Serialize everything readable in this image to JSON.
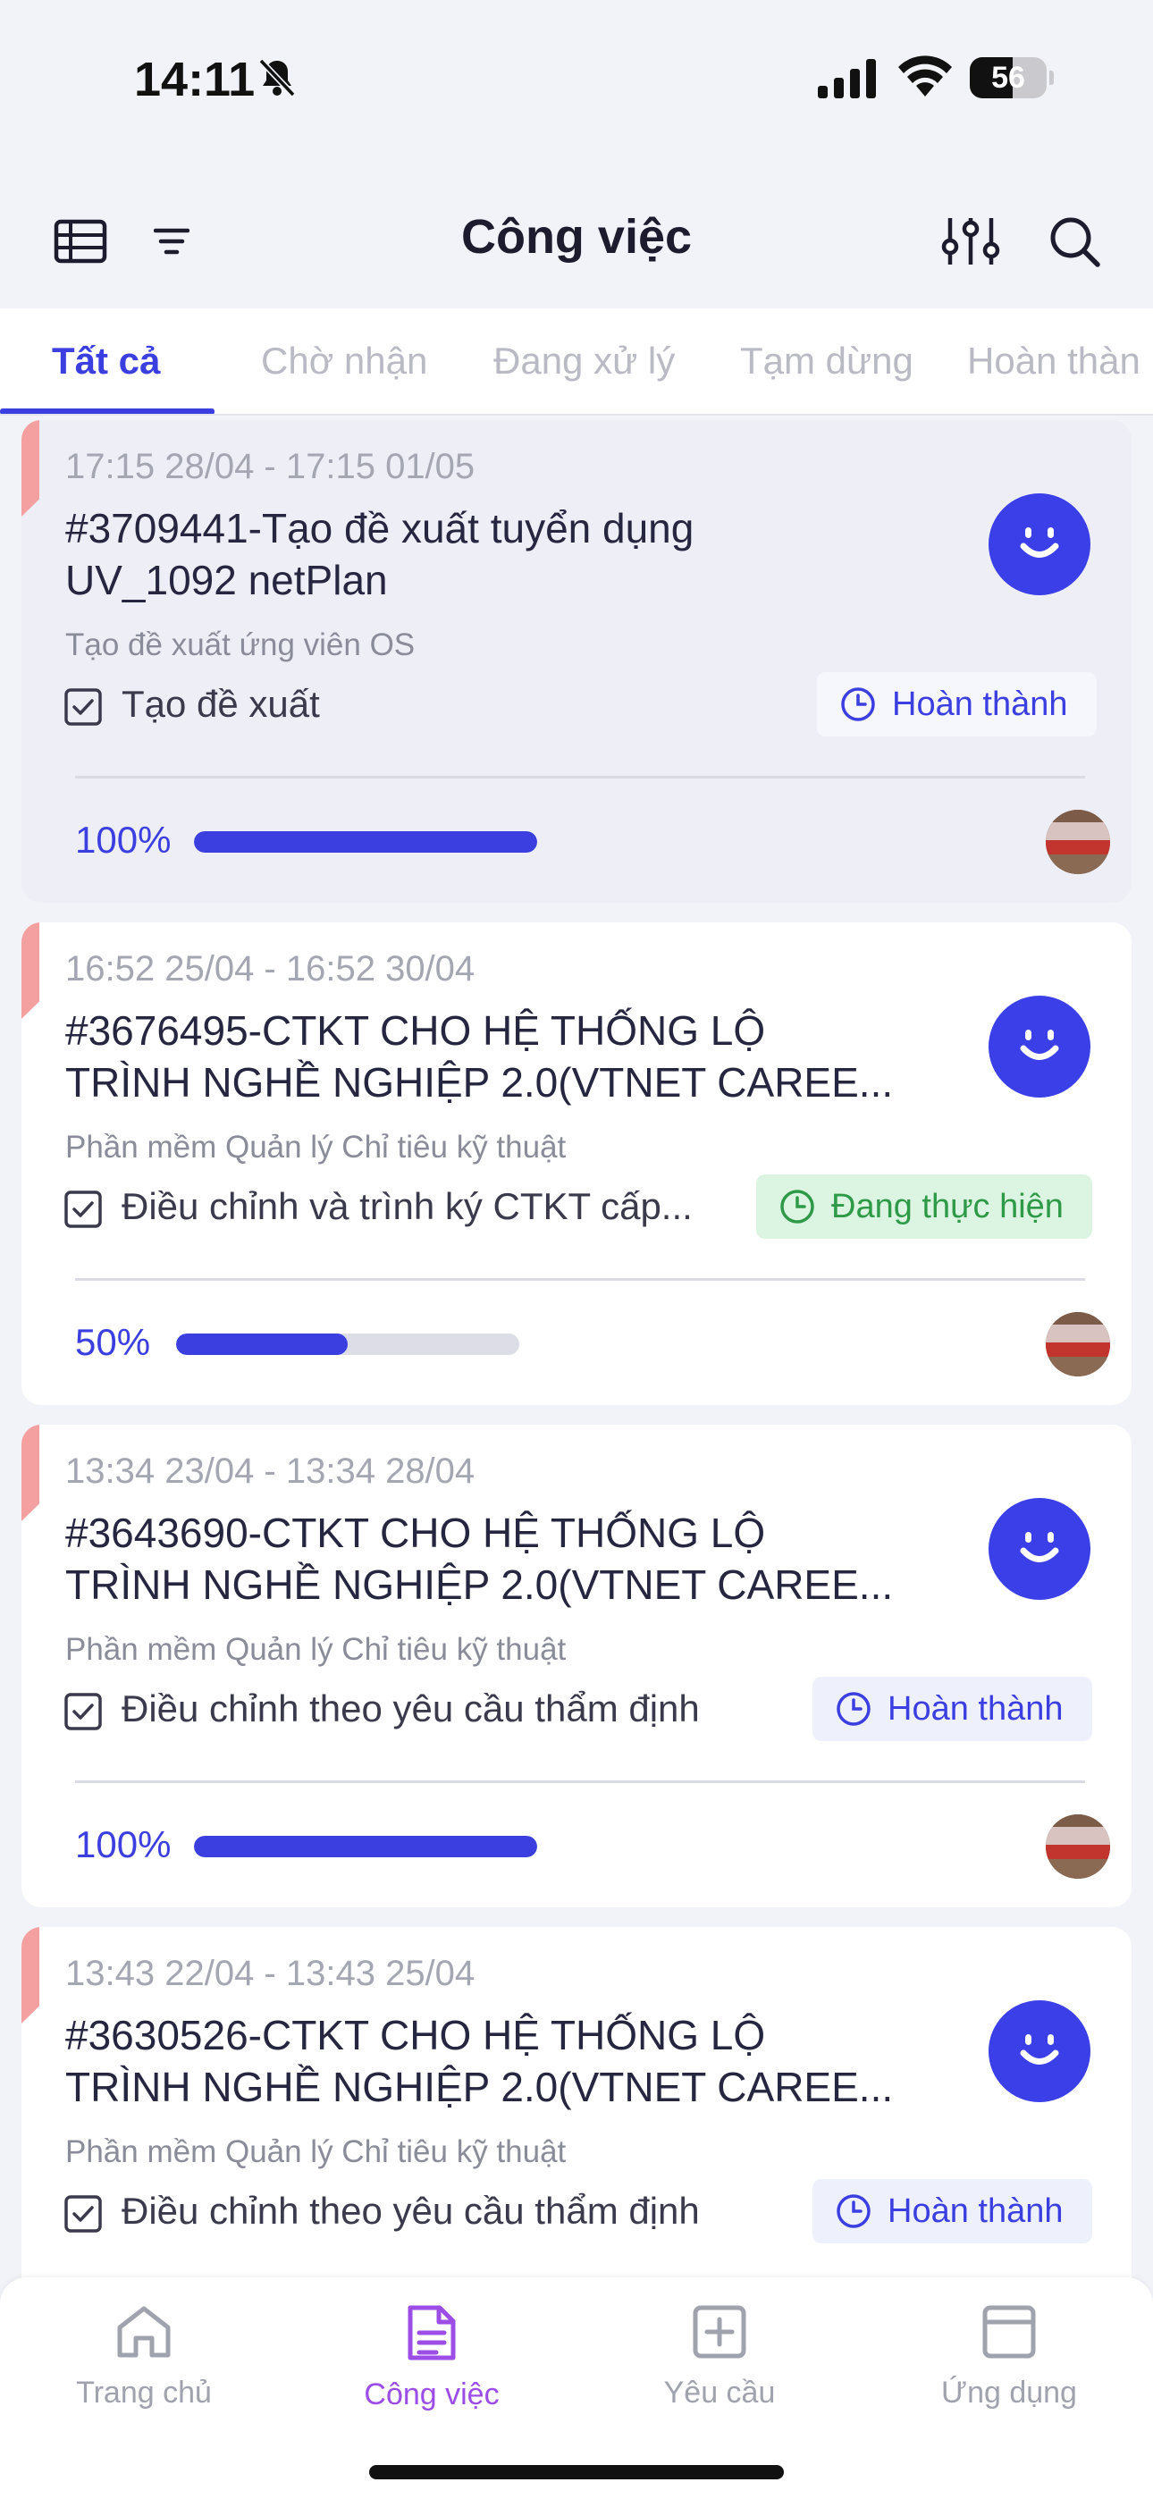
{
  "status_bar": {
    "time": "14:11",
    "battery": "56",
    "icons": [
      "bell-slash-icon",
      "cellular-signal-icon",
      "wifi-icon",
      "battery-icon"
    ]
  },
  "header": {
    "title": "Công việc",
    "icons": {
      "left": [
        "list-view-icon",
        "sort-icon"
      ],
      "right": [
        "sliders-icon",
        "search-icon"
      ]
    }
  },
  "tabs": [
    {
      "label": "Tất cả",
      "active": true
    },
    {
      "label": "Chờ nhận"
    },
    {
      "label": "Đang xử lý"
    },
    {
      "label": "Tạm dừng"
    },
    {
      "label": "Hoàn thàn"
    }
  ],
  "colors": {
    "accent": "#3b3fe0",
    "flag": "#f5a0a0",
    "doing_bg": "#dcf5e2",
    "doing_text": "#2e9a47",
    "nav_active": "#9b4de6"
  },
  "tasks": [
    {
      "time_range": "17:15 28/04 - 17:15 01/05",
      "title_line1": "#3709441-Tạo đề xuất tuyển dụng",
      "title_line2": "UV_1092 netPlan",
      "subtitle": "Tạo đề xuất ứng viên OS",
      "step": "Tạo đề xuất",
      "status": "Hoàn thành",
      "progress_label": "100%",
      "progress": 1.0
    },
    {
      "time_range": "16:52 25/04 - 16:52 30/04",
      "title_line1": "#3676495-CTKT CHO HỆ THỐNG LỘ",
      "title_line2": "TRÌNH NGHỀ NGHIỆP 2.0(VTNET CAREE...",
      "subtitle": "Phần mềm Quản lý Chỉ tiêu kỹ thuật",
      "step": "Điều chỉnh và trình ký CTKT cấp...",
      "status": "Đang thực hiện",
      "progress_label": "50%",
      "progress": 0.5
    },
    {
      "time_range": "13:34 23/04 - 13:34 28/04",
      "title_line1": "#3643690-CTKT CHO HỆ THỐNG LỘ",
      "title_line2": "TRÌNH NGHỀ NGHIỆP 2.0(VTNET CAREE...",
      "subtitle": "Phần mềm Quản lý Chỉ tiêu kỹ thuật",
      "step": "Điều chỉnh theo yêu cầu thẩm định",
      "status": "Hoàn thành",
      "progress_label": "100%",
      "progress": 1.0
    },
    {
      "time_range": "13:43 22/04 - 13:43 25/04",
      "title_line1": "#3630526-CTKT CHO HỆ THỐNG LỘ",
      "title_line2": "TRÌNH NGHỀ NGHIỆP 2.0(VTNET CAREE...",
      "subtitle": "Phần mềm Quản lý Chỉ tiêu kỹ thuật",
      "step": "Điều chỉnh theo yêu cầu thẩm định",
      "status": "Hoàn thành"
    }
  ],
  "bottom_nav": [
    {
      "label": "Trang chủ",
      "icon": "home-icon"
    },
    {
      "label": "Công việc",
      "icon": "document-icon",
      "active": true
    },
    {
      "label": "Yêu cầu",
      "icon": "plus-square-icon"
    },
    {
      "label": "Ứng dụng",
      "icon": "app-window-icon"
    }
  ]
}
